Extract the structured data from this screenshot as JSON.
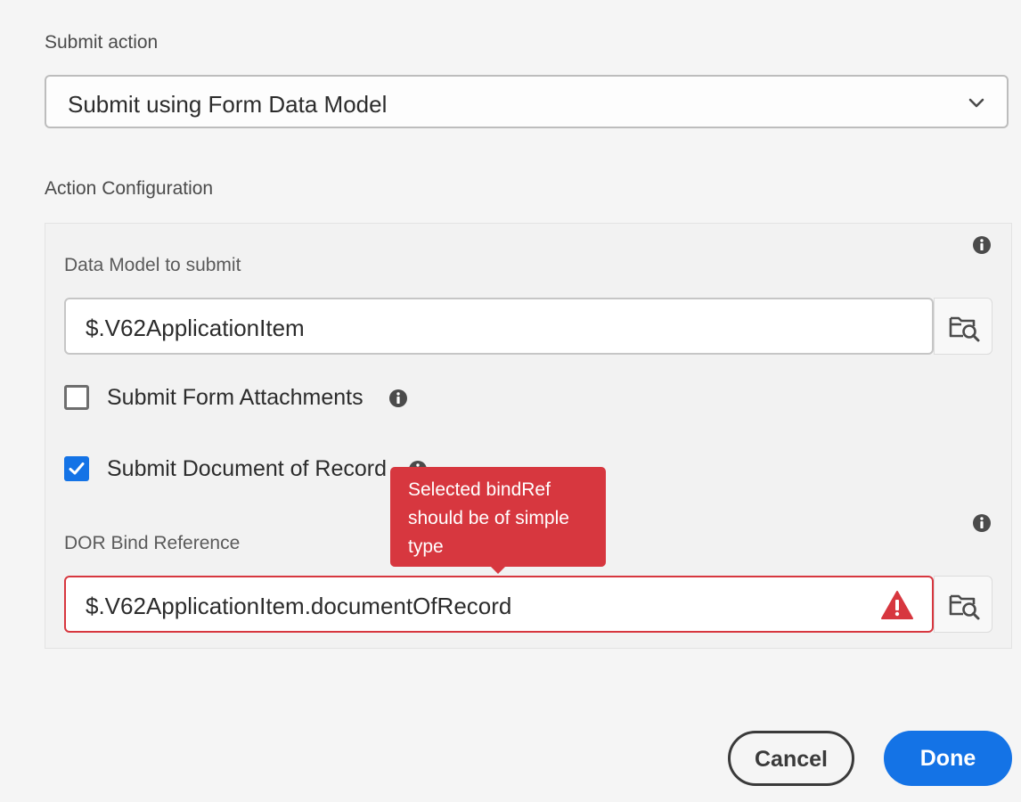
{
  "submit_action": {
    "label": "Submit action",
    "selected": "Submit using Form Data Model",
    "icon": "chevron-down-icon"
  },
  "action_configuration": {
    "label": "Action Configuration",
    "data_model": {
      "label": "Data Model to submit",
      "value": "$.V62ApplicationItem",
      "browse_icon": "folder-search-icon",
      "info_icon": "info-icon"
    },
    "submit_attachments": {
      "label": "Submit Form Attachments",
      "checked": false
    },
    "submit_dor": {
      "label": "Submit Document of Record",
      "checked": true
    },
    "dor_bind_reference": {
      "label": "DOR Bind Reference",
      "value": "$.V62ApplicationItem.documentOfRecord",
      "invalid": true,
      "error_tooltip": [
        "Selected bindRef",
        "should be of simple",
        "type"
      ],
      "alert_icon": "alert-triangle-icon",
      "browse_icon": "folder-search-icon"
    }
  },
  "colors": {
    "accent": "#1473e6",
    "error": "#d7373f",
    "background": "#f5f5f5"
  },
  "buttons": {
    "cancel": "Cancel",
    "done": "Done"
  }
}
